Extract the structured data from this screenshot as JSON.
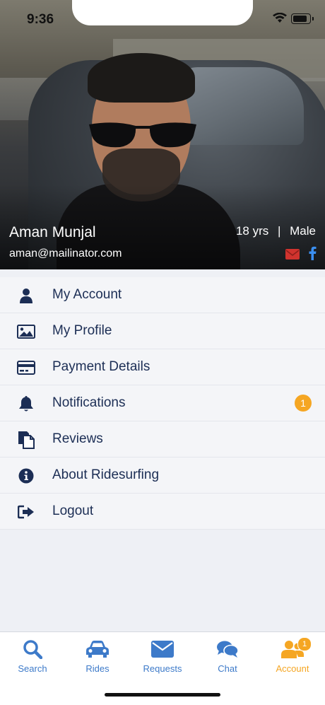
{
  "status_bar": {
    "time": "9:36"
  },
  "profile": {
    "name": "Aman Munjal",
    "email": "aman@mailinator.com",
    "age": "18 yrs",
    "separator": "|",
    "gender": "Male"
  },
  "menu": {
    "items": [
      {
        "label": "My Account",
        "icon": "user-icon"
      },
      {
        "label": "My Profile",
        "icon": "image-icon"
      },
      {
        "label": "Payment Details",
        "icon": "credit-card-icon"
      },
      {
        "label": "Notifications",
        "icon": "bell-icon",
        "badge": "1"
      },
      {
        "label": "Reviews",
        "icon": "documents-icon"
      },
      {
        "label": "About Ridesurfing",
        "icon": "info-icon"
      },
      {
        "label": "Logout",
        "icon": "logout-icon"
      }
    ]
  },
  "tabs": [
    {
      "label": "Search",
      "icon": "search-icon"
    },
    {
      "label": "Rides",
      "icon": "car-icon"
    },
    {
      "label": "Requests",
      "icon": "envelope-icon"
    },
    {
      "label": "Chat",
      "icon": "chat-icon"
    },
    {
      "label": "Account",
      "icon": "users-icon",
      "badge": "1",
      "active": true
    }
  ],
  "colors": {
    "nav_text": "#1c2e55",
    "tab_blue": "#3d7ac9",
    "accent_orange": "#f5a623",
    "mail_red": "#d0332e",
    "facebook_blue": "#3b8ff0"
  }
}
